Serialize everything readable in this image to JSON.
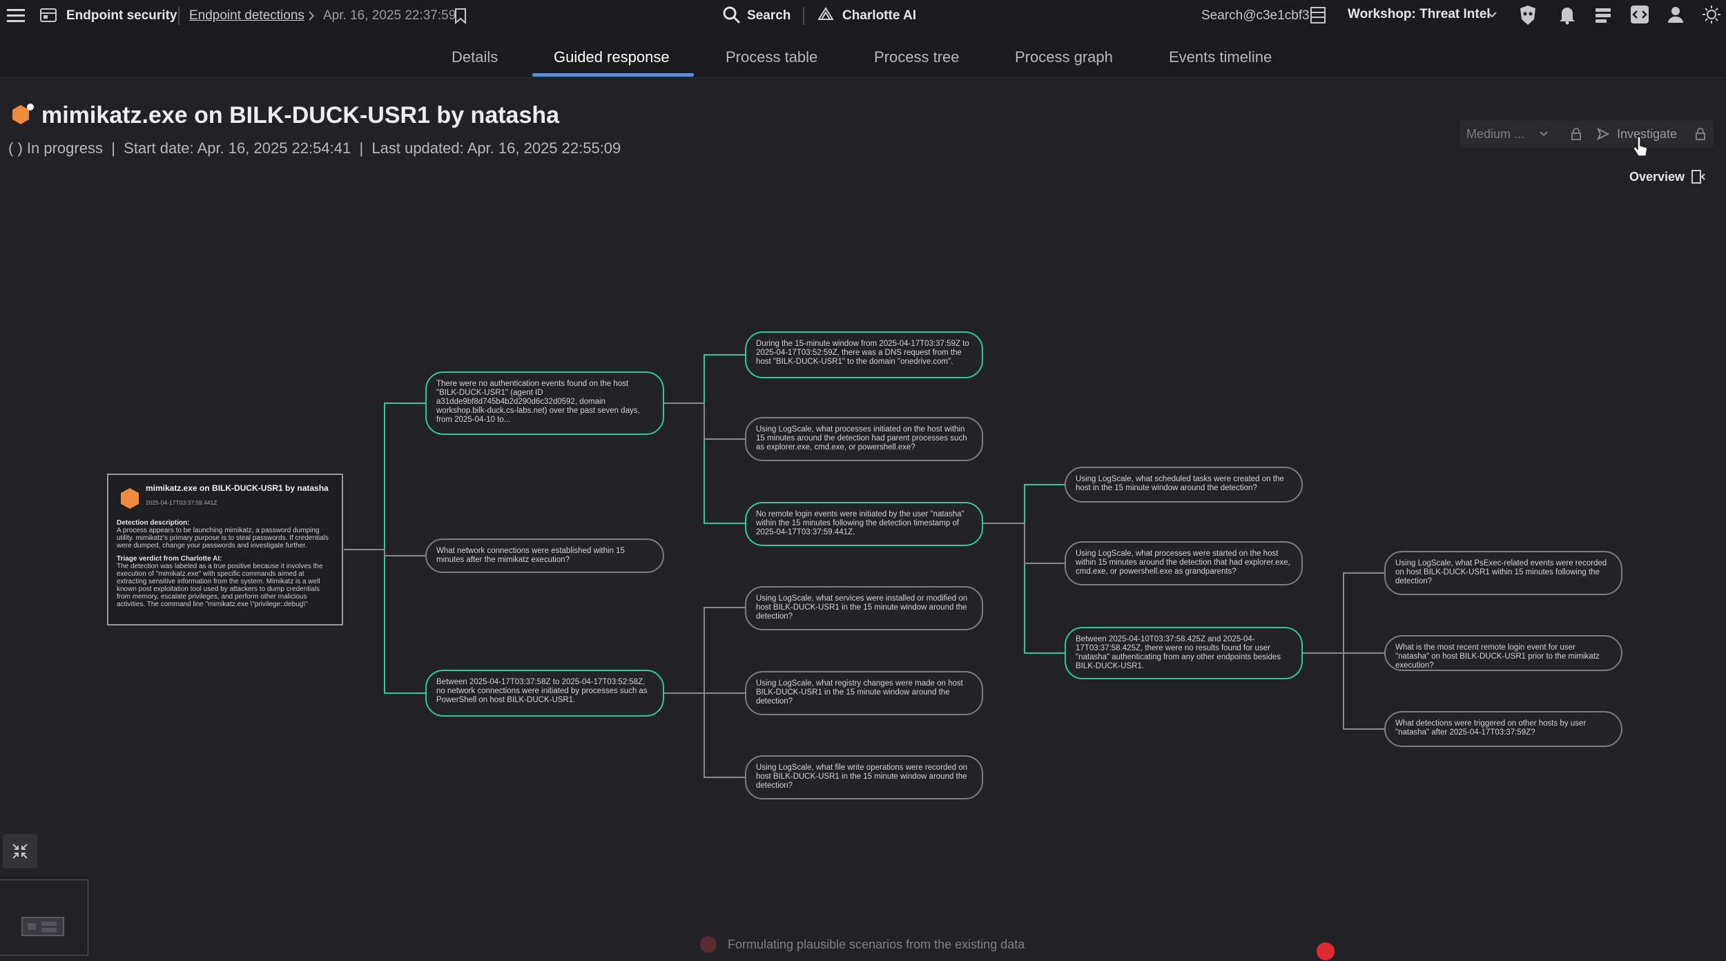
{
  "app": {
    "section": "Endpoint security",
    "breadcrumb_link": "Endpoint detections",
    "breadcrumb_current": "Apr. 16, 2025 22:37:59",
    "search_label": "Search",
    "ai_label": "Charlotte AI",
    "user_search": "Search@c3e1cbf3",
    "workspace": "Workshop: Threat Intel"
  },
  "tabs": [
    {
      "label": "Details",
      "active": false
    },
    {
      "label": "Guided response",
      "active": true
    },
    {
      "label": "Process table",
      "active": false
    },
    {
      "label": "Process tree",
      "active": false
    },
    {
      "label": "Process graph",
      "active": false
    },
    {
      "label": "Events timeline",
      "active": false
    }
  ],
  "detection": {
    "title": "mimikatz.exe on BILK-DUCK-USR1 by natasha",
    "status_icon": "( )",
    "status": "In progress",
    "start_label": "Start date:",
    "start_value": "Apr. 16, 2025 22:54:41",
    "updated_label": "Last updated:",
    "updated_value": "Apr. 16, 2025 22:55:09",
    "separator": "|"
  },
  "controls": {
    "severity": "Medium ...",
    "investigate": "Investigate",
    "overview": "Overview"
  },
  "root_card": {
    "title": "mimikatz.exe on BILK-DUCK-USR1 by natasha",
    "timestamp": "2025-04-17T03:37:59.441Z",
    "desc_heading": "Detection description:",
    "desc": "A process appears to be launching mimikatz, a password dumping utility. mimikatz's primary purpose is to steal passwords. If credentials were dumped, change your passwords and investigate further.",
    "verdict_heading": "Triage verdict from Charlotte AI:",
    "verdict": "The detection was labeled as a true positive because it involves the execution of \"mimikatz.exe\" with specific commands aimed at extracting sensitive information from the system. Mimikatz is a well known post exploitation tool used by attackers to dump credentials from memory, escalate privileges, and perform other malicious activities. The command line \"mimikatz.exe \\\"privilege::debug\\\""
  },
  "nodes": {
    "n1": "There were no authentication events found on the host \"BILK-DUCK-USR1\" (agent ID a31dde9bf8d745b4b2d290d6c32d0592, domain workshop.bilk-duck.cs-labs.net) over the past seven days, from 2025-04-10 to...",
    "n2": "What network connections were established within 15 minutes after the mimikatz execution?",
    "n3": "Between 2025-04-17T03:37:58Z to 2025-04-17T03:52:58Z, no network connections were initiated by processes such as PowerShell on host BILK-DUCK-USR1.",
    "n4": "During the 15-minute window from 2025-04-17T03:37:59Z to 2025-04-17T03:52:59Z, there was a DNS request from the host \"BILK-DUCK-USR1\" to the domain \"onedrive.com\".",
    "n5": "Using LogScale, what processes initiated on the host within 15 minutes around the detection had parent processes such as explorer.exe, cmd.exe, or powershell.exe?",
    "n6": "No remote login events were initiated by the user \"natasha\" within the 15 minutes following the detection timestamp of 2025-04-17T03:37:59.441Z.",
    "n7": "Using LogScale, what services were installed or modified on host BILK-DUCK-USR1 in the 15 minute window around the detection?",
    "n8": "Using LogScale, what registry changes were made on host BILK-DUCK-USR1 in the 15 minute window around the detection?",
    "n9": "Using LogScale, what file write operations were recorded on host BILK-DUCK-USR1 in the 15 minute window around the detection?",
    "n10": "Using LogScale, what scheduled tasks were created on the host in the 15 minute window around the detection?",
    "n11": "Using LogScale, what processes were started on the host within 15 minutes around the detection that had explorer.exe, cmd.exe, or powershell.exe as grandparents?",
    "n12": "Between 2025-04-10T03:37:58.425Z and 2025-04-17T03:37:58.425Z, there were no results found for user \"natasha\" authenticating from any other endpoints besides BILK-DUCK-USR1.",
    "n13": "Using LogScale, what PsExec-related events were recorded on host BILK-DUCK-USR1 within 15 minutes following the detection?",
    "n14": "What is the most recent remote login event for user \"natasha\" on host BILK-DUCK-USR1 prior to the mimikatz execution?",
    "n15": "What detections were triggered on other hosts by user \"natasha\" after 2025-04-17T03:37:59Z?"
  },
  "status_bar": "Formulating plausible scenarios from the existing data",
  "colors": {
    "accent": "#2ecc94",
    "tab_underline": "#5a8fd6",
    "severity_icon": "#f08a3c"
  }
}
